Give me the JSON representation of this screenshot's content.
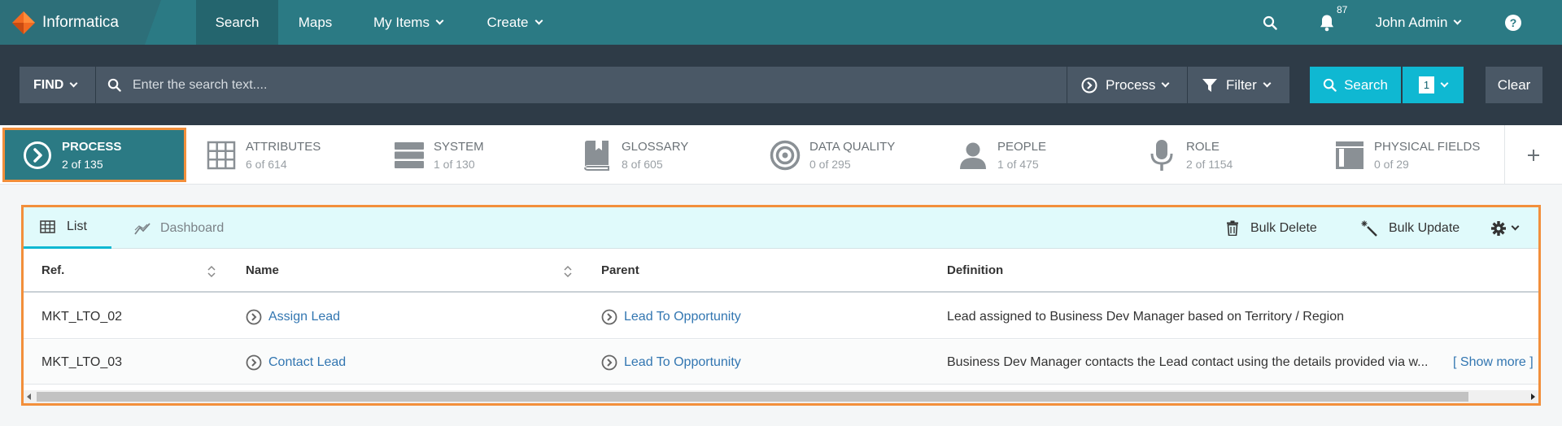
{
  "brand": {
    "name": "Informatica"
  },
  "nav": {
    "items": [
      {
        "label": "Search"
      },
      {
        "label": "Maps"
      },
      {
        "label": "My Items"
      },
      {
        "label": "Create"
      }
    ],
    "notifications": "87",
    "user": "John Admin"
  },
  "search": {
    "find_label": "FIND",
    "placeholder": "Enter the search text....",
    "type_label": "Process",
    "filter_label": "Filter",
    "search_label": "Search",
    "count": "1",
    "clear_label": "Clear"
  },
  "categories": [
    {
      "label": "PROCESS",
      "count": "2 of 135"
    },
    {
      "label": "ATTRIBUTES",
      "count": "6 of 614"
    },
    {
      "label": "SYSTEM",
      "count": "1 of 130"
    },
    {
      "label": "GLOSSARY",
      "count": "8 of 605"
    },
    {
      "label": "DATA QUALITY",
      "count": "0 of 295"
    },
    {
      "label": "PEOPLE",
      "count": "1 of 475"
    },
    {
      "label": "ROLE",
      "count": "2 of 1154"
    },
    {
      "label": "PHYSICAL FIELDS",
      "count": "0 of 29"
    }
  ],
  "panel": {
    "tabs": [
      {
        "label": "List"
      },
      {
        "label": "Dashboard"
      }
    ],
    "bulk_delete": "Bulk Delete",
    "bulk_update": "Bulk Update",
    "columns": [
      {
        "label": "Ref."
      },
      {
        "label": "Name"
      },
      {
        "label": "Parent"
      },
      {
        "label": "Definition"
      }
    ],
    "rows": [
      {
        "ref": "MKT_LTO_02",
        "name": "Assign Lead",
        "parent": "Lead To Opportunity",
        "definition": "Lead assigned to Business Dev Manager based on Territory / Region"
      },
      {
        "ref": "MKT_LTO_03",
        "name": "Contact Lead",
        "parent": "Lead To Opportunity",
        "definition": "Business Dev Manager contacts the Lead contact using the details provided via w...",
        "show_more": "[ Show more ]"
      }
    ]
  },
  "colors": {
    "nav": "#2b7a84",
    "band": "#2e3b47",
    "accent": "#0fb8d2",
    "highlight": "#f28f3b",
    "link": "#3276b1"
  },
  "icons": [
    "informatica-logo-icon",
    "search-icon",
    "bell-icon",
    "help-icon",
    "chevron-down-icon",
    "process-icon",
    "filter-icon",
    "grid-icon",
    "server-icon",
    "book-icon",
    "target-icon",
    "person-icon",
    "microphone-icon",
    "fields-icon",
    "plus-icon",
    "list-icon",
    "chart-line-icon",
    "trash-icon",
    "magic-wand-icon",
    "gear-icon",
    "sort-icon"
  ]
}
